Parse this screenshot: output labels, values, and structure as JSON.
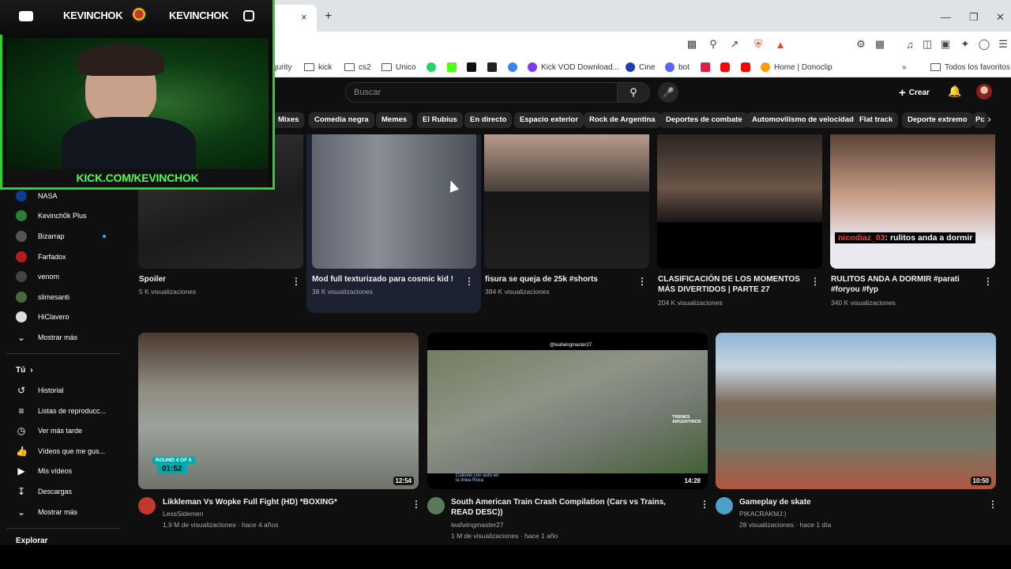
{
  "browser": {
    "tab_close": "×",
    "new_tab": "+",
    "bookmarks": [
      {
        "label": "gurity",
        "type": "text"
      },
      {
        "label": "kick",
        "type": "folder"
      },
      {
        "label": "cs2",
        "type": "folder"
      },
      {
        "label": "Unico",
        "type": "folder"
      },
      {
        "label": "Kick VOD Download...",
        "type": "site"
      },
      {
        "label": "Cine",
        "type": "site"
      },
      {
        "label": "bot",
        "type": "site"
      },
      {
        "label": "Home | Donoclip",
        "type": "site"
      },
      {
        "label": "Todos los favoritos",
        "type": "folder"
      }
    ],
    "more_bookmarks": "»"
  },
  "youtube": {
    "search_placeholder": "Buscar",
    "create_label": "Crear",
    "chips": [
      "Mixes",
      "Comedia negra",
      "Memes",
      "El Rubius",
      "En directo",
      "Espacio exterior",
      "Rock de Argentina",
      "Deportes de combate",
      "Automovilismo de velocidad",
      "Flat track",
      "Deporte extremo",
      "Pc"
    ],
    "sidebar": {
      "subscriptions": [
        "NASA",
        "Kevinch0k Plus",
        "Bizarrap",
        "Farfadox",
        "venom",
        "slimesanti",
        "HiClavero"
      ],
      "show_more": "Mostrar más",
      "you_header": "Tú",
      "you_items": [
        "Historial",
        "Listas de reproducc...",
        "Ver más tarde",
        "Vídeos que me gus...",
        "Mis vídeos",
        "Descargas"
      ],
      "show_more_2": "Mostrar más",
      "explore": "Explorar"
    },
    "shorts": [
      {
        "title": "Spoiler",
        "views": "5 K visualizaciones"
      },
      {
        "title": "Mod full texturizado para cosmic kid !",
        "views": "38 K visualizaciones"
      },
      {
        "title": "fisura se queja de 25k #shorts",
        "views": "384 K visualizaciones"
      },
      {
        "title": "CLASIFICACIÓN DE LOS MOMENTOS MÁS DIVERTIDOS | PARTE 27",
        "views": "204 K visualizaciones"
      },
      {
        "title": "RULITOS ANDA A DORMIR #parati #foryou #fyp",
        "views": "340 K visualizaciones",
        "caption_user": "nicodiaz_03",
        "caption_text": ": rulitos anda a dormir"
      }
    ],
    "videos": [
      {
        "title": "Likkleman Vs Wopke Full Fight (HD) *BOXING*",
        "channel": "LessSidemen",
        "stats": "1,9 M de visualizaciones · hace 4 años",
        "duration": "12:54",
        "overlay": "ROUND 4 OF 6",
        "overlay_time": "01:52"
      },
      {
        "title": "South American Train Crash Compilation (Cars vs Trains, READ DESC))",
        "channel": "leafwingmaster27",
        "stats": "1 M de visualizaciones · hace 1 año",
        "duration": "14:28",
        "watermark": "@leafwingmaster27",
        "caption": "Colisión con auto en la línea Roca",
        "badge": "TRENES ARGENTINOS"
      },
      {
        "title": "Gameplay de skate",
        "channel": "PIKACRAKMJ:)",
        "stats": "28 visualizaciones · hace 1 día",
        "duration": "10:50"
      }
    ]
  },
  "stream_overlay": {
    "name_left": "KEVINCHOK",
    "name_right": "KEVINCHOK",
    "url": "KICK.COM/KEVINCHOK"
  }
}
